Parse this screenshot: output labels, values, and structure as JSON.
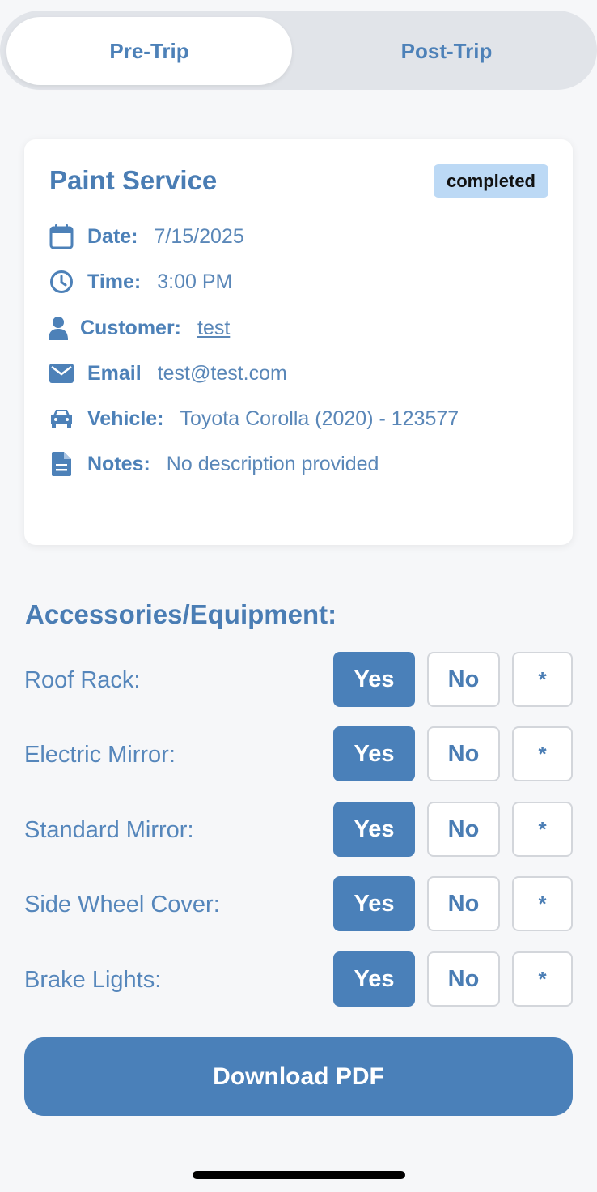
{
  "tabs": {
    "pre_trip": "Pre-Trip",
    "post_trip": "Post-Trip",
    "active": "pre_trip"
  },
  "card": {
    "title": "Paint Service",
    "status": "completed",
    "date": {
      "label": "Date:",
      "value": "7/15/2025"
    },
    "time": {
      "label": "Time:",
      "value": "3:00 PM"
    },
    "customer": {
      "label": "Customer:",
      "value": "test"
    },
    "email": {
      "label": "Email",
      "value": "test@test.com"
    },
    "vehicle": {
      "label": "Vehicle:",
      "value": "Toyota Corolla (2020) - 123577"
    },
    "notes": {
      "label": "Notes:",
      "value": "No description provided"
    }
  },
  "accessories": {
    "title": "Accessories/Equipment:",
    "items": [
      {
        "label": "Roof Rack:",
        "selected": "Yes"
      },
      {
        "label": "Electric Mirror:",
        "selected": "Yes"
      },
      {
        "label": "Standard Mirror:",
        "selected": "Yes"
      },
      {
        "label": "Side Wheel Cover:",
        "selected": "Yes"
      },
      {
        "label": "Brake Lights:",
        "selected": "Yes"
      }
    ],
    "options": {
      "yes": "Yes",
      "no": "No",
      "other": "*"
    }
  },
  "download_label": "Download PDF",
  "colors": {
    "accent": "#4a80b9",
    "badge": "#bcd9f5",
    "background": "#f6f7f9"
  }
}
